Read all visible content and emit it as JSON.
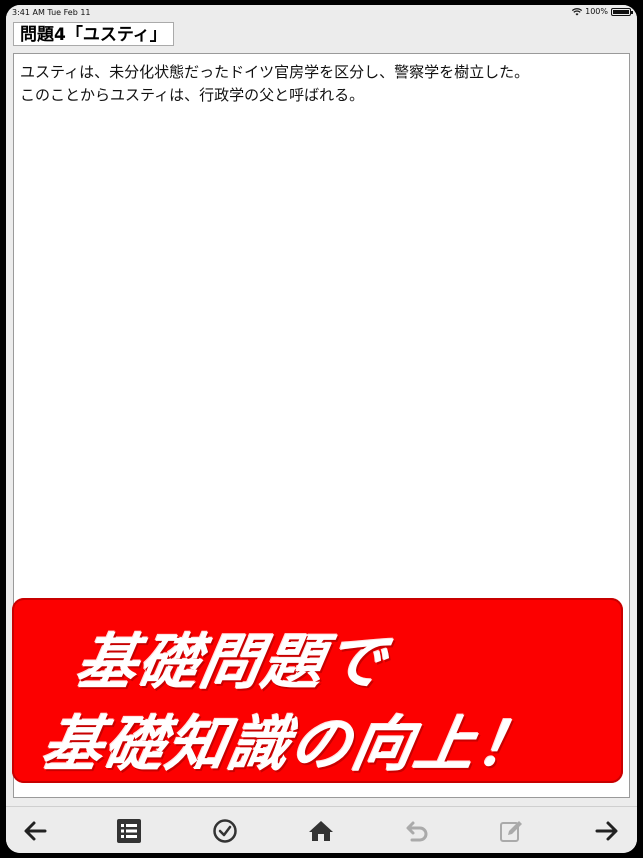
{
  "status_bar": {
    "time": "3:41 AM  Tue Feb 11",
    "battery": "100%"
  },
  "question": {
    "title": "問題4「ユスティ」",
    "body": "ユスティは、未分化状態だったドイツ官房学を区分し、警察学を樹立した。\nこのことからユスティは、行政学の父と呼ばれる。"
  },
  "banner": {
    "line1": "基礎問題で",
    "line2": "基礎知識の向上！",
    "color": "#fc0000"
  },
  "toolbar": {
    "icons": [
      "arrow-left-icon",
      "list-icon",
      "check-circle-icon",
      "home-icon",
      "undo-icon",
      "edit-icon",
      "arrow-right-icon"
    ]
  }
}
